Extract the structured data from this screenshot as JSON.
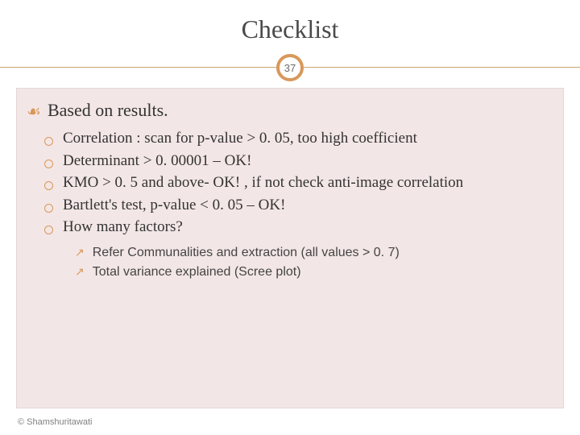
{
  "title": "Checklist",
  "page_number": "37",
  "heading": "Based on results.",
  "items": [
    "Correlation : scan for p-value > 0. 05, too high coefficient",
    "Determinant > 0. 00001 – OK!",
    "KMO > 0. 5 and above- OK! , if not check anti-image correlation",
    "Bartlett's test, p-value < 0. 05 – OK!",
    "How many factors?"
  ],
  "subitems": [
    "Refer Communalities and extraction (all values > 0. 7)",
    "Total variance explained (Scree plot)"
  ],
  "footer": "© Shamshuritawati"
}
